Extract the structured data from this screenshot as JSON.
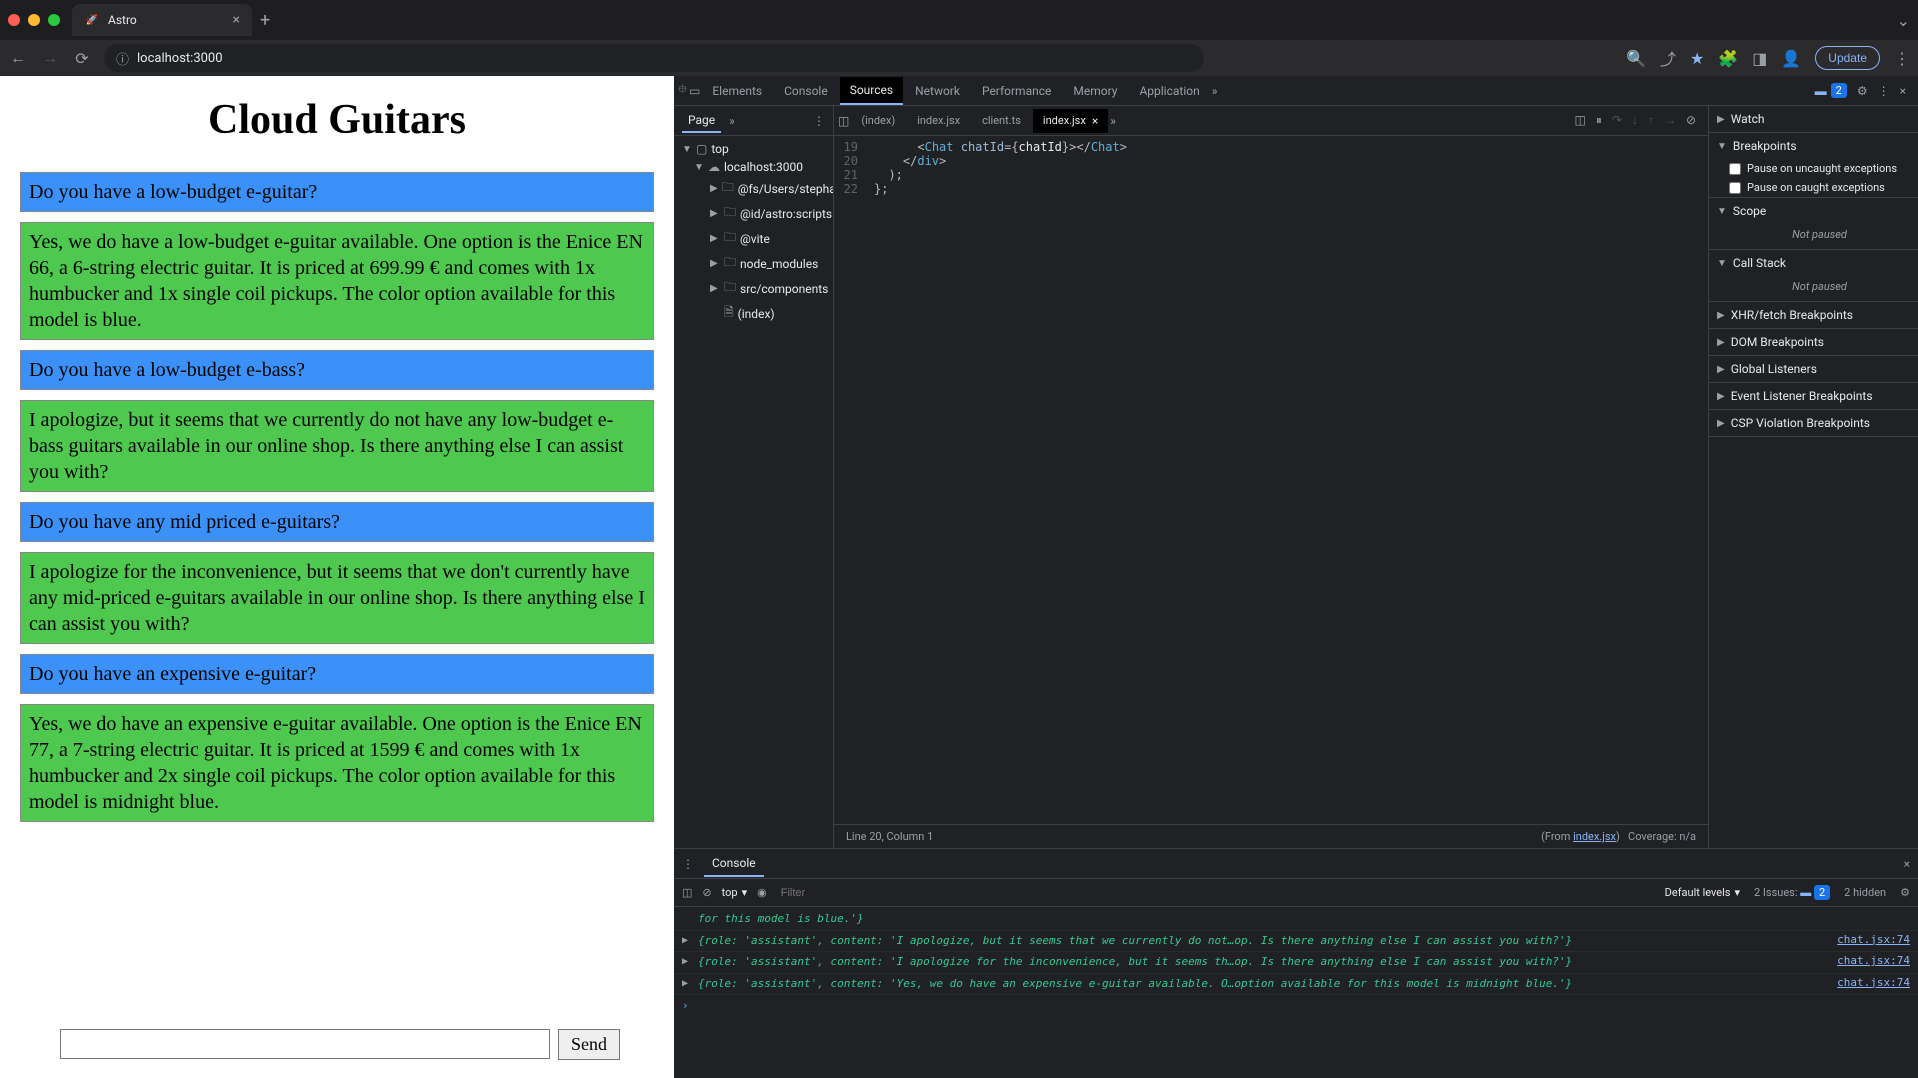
{
  "browser": {
    "tab_title": "Astro",
    "url": "localhost:3000",
    "update_label": "Update"
  },
  "page": {
    "title": "Cloud Guitars",
    "send_label": "Send",
    "messages": [
      {
        "role": "user",
        "text": "Do you have a low-budget e-guitar?"
      },
      {
        "role": "assistant",
        "text": "Yes, we do have a low-budget e-guitar available. One option is the Enice EN 66, a 6-string electric guitar. It is priced at 699.99 € and comes with 1x humbucker and 1x single coil pickups. The color option available for this model is blue."
      },
      {
        "role": "user",
        "text": "Do you have a low-budget e-bass?"
      },
      {
        "role": "assistant",
        "text": "I apologize, but it seems that we currently do not have any low-budget e-bass guitars available in our online shop. Is there anything else I can assist you with?"
      },
      {
        "role": "user",
        "text": "Do you have any mid priced e-guitars?"
      },
      {
        "role": "assistant",
        "text": "I apologize for the inconvenience, but it seems that we don't currently have any mid-priced e-guitars available in our online shop. Is there anything else I can assist you with?"
      },
      {
        "role": "user",
        "text": "Do you have an expensive e-guitar?"
      },
      {
        "role": "assistant",
        "text": "Yes, we do have an expensive e-guitar available. One option is the Enice EN 77, a 7-string electric guitar. It is priced at 1599 € and comes with 1x humbucker and 2x single coil pickups. The color option available for this model is midnight blue."
      }
    ]
  },
  "devtools": {
    "tabs": [
      "Elements",
      "Console",
      "Sources",
      "Network",
      "Performance",
      "Memory",
      "Application"
    ],
    "active_tab": "Sources",
    "issues_count": "2",
    "sources": {
      "left_header": "Page",
      "tree": {
        "top": "top",
        "host": "localhost:3000",
        "folders": [
          "@fs/Users/stepha",
          "@id/astro:scripts",
          "@vite",
          "node_modules",
          "src/components"
        ],
        "file": "(index)"
      },
      "editor_tabs": [
        "(index)",
        "index.jsx",
        "client.ts",
        "index.jsx"
      ],
      "active_editor_tab": "index.jsx",
      "code_lines": [
        {
          "no": "19",
          "html": "      <span class='tok-punc'>&lt;</span><span class='tok-tag'>Chat</span> <span class='tok-attr'>chatId</span><span class='tok-punc'>={</span>chatId<span class='tok-punc'>}&gt;&lt;/</span><span class='tok-tag'>Chat</span><span class='tok-punc'>&gt;</span>"
        },
        {
          "no": "20",
          "html": "    <span class='tok-punc'>&lt;/</span><span class='tok-tag'>div</span><span class='tok-punc'>&gt;</span>"
        },
        {
          "no": "21",
          "html": "  <span class='tok-punc'>);</span>"
        },
        {
          "no": "22",
          "html": "<span class='tok-punc'>};</span>"
        }
      ],
      "status_line": "Line 20, Column 1",
      "status_from": "(From ",
      "status_from_link": "index.jsx",
      "status_from_suffix": ")",
      "coverage": "Coverage: n/a"
    },
    "right": {
      "watch": "Watch",
      "breakpoints": "Breakpoints",
      "bp_uncaught": "Pause on uncaught exceptions",
      "bp_caught": "Pause on caught exceptions",
      "scope": "Scope",
      "scope_not_paused": "Not paused",
      "callstack": "Call Stack",
      "callstack_not_paused": "Not paused",
      "xhr": "XHR/fetch Breakpoints",
      "dom": "DOM Breakpoints",
      "global": "Global Listeners",
      "event": "Event Listener Breakpoints",
      "csp": "CSP Violation Breakpoints"
    },
    "console": {
      "header": "Console",
      "context": "top",
      "filter_placeholder": "Filter",
      "levels": "Default levels",
      "issues": "2 Issues:",
      "hidden": "2 hidden",
      "messages": [
        {
          "body": "for this model is blue.'}",
          "src": ""
        },
        {
          "body": "{role: 'assistant', content: 'I apologize, but it seems that we currently do not…op. Is there anything else I can assist you with?'}",
          "src": "chat.jsx:74"
        },
        {
          "body": "{role: 'assistant', content: 'I apologize for the inconvenience, but it seems th…op. Is there anything else I can assist you with?'}",
          "src": "chat.jsx:74"
        },
        {
          "body": "{role: 'assistant', content: 'Yes, we do have an expensive e-guitar available. O…option available for this model is midnight blue.'}",
          "src": "chat.jsx:74"
        }
      ]
    }
  }
}
